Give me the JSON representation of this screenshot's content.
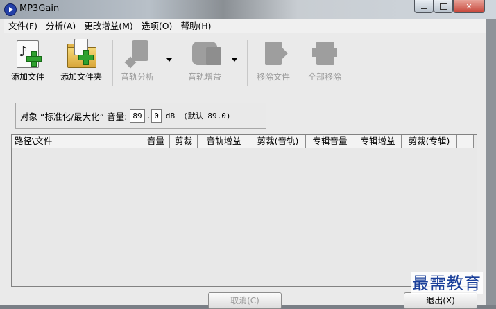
{
  "window": {
    "title": "MP3Gain"
  },
  "menu": [
    {
      "label": "文件(F)"
    },
    {
      "label": "分析(A)"
    },
    {
      "label": "更改增益(M)"
    },
    {
      "label": "选项(O)"
    },
    {
      "label": "帮助(H)"
    }
  ],
  "toolbar": {
    "add_file": "添加文件",
    "add_folder": "添加文件夹",
    "track_analysis": "音轨分析",
    "track_gain": "音轨增益",
    "remove_file": "移除文件",
    "remove_all": "全部移除"
  },
  "target_volume": {
    "label": "对象 “标准化/最大化” 音量:",
    "integer": "89",
    "sep": ".",
    "decimal": "0",
    "unit": "dB",
    "default_text": "(默认 89.0)"
  },
  "columns": [
    {
      "label": "路径\\文件"
    },
    {
      "label": "音量"
    },
    {
      "label": "剪裁"
    },
    {
      "label": "音轨增益"
    },
    {
      "label": "剪裁(音轨)"
    },
    {
      "label": "专辑音量"
    },
    {
      "label": "专辑增益"
    },
    {
      "label": "剪裁(专辑)"
    }
  ],
  "buttons": {
    "cancel": "取消(C)",
    "exit": "退出(X)"
  },
  "watermark": "最需教育"
}
